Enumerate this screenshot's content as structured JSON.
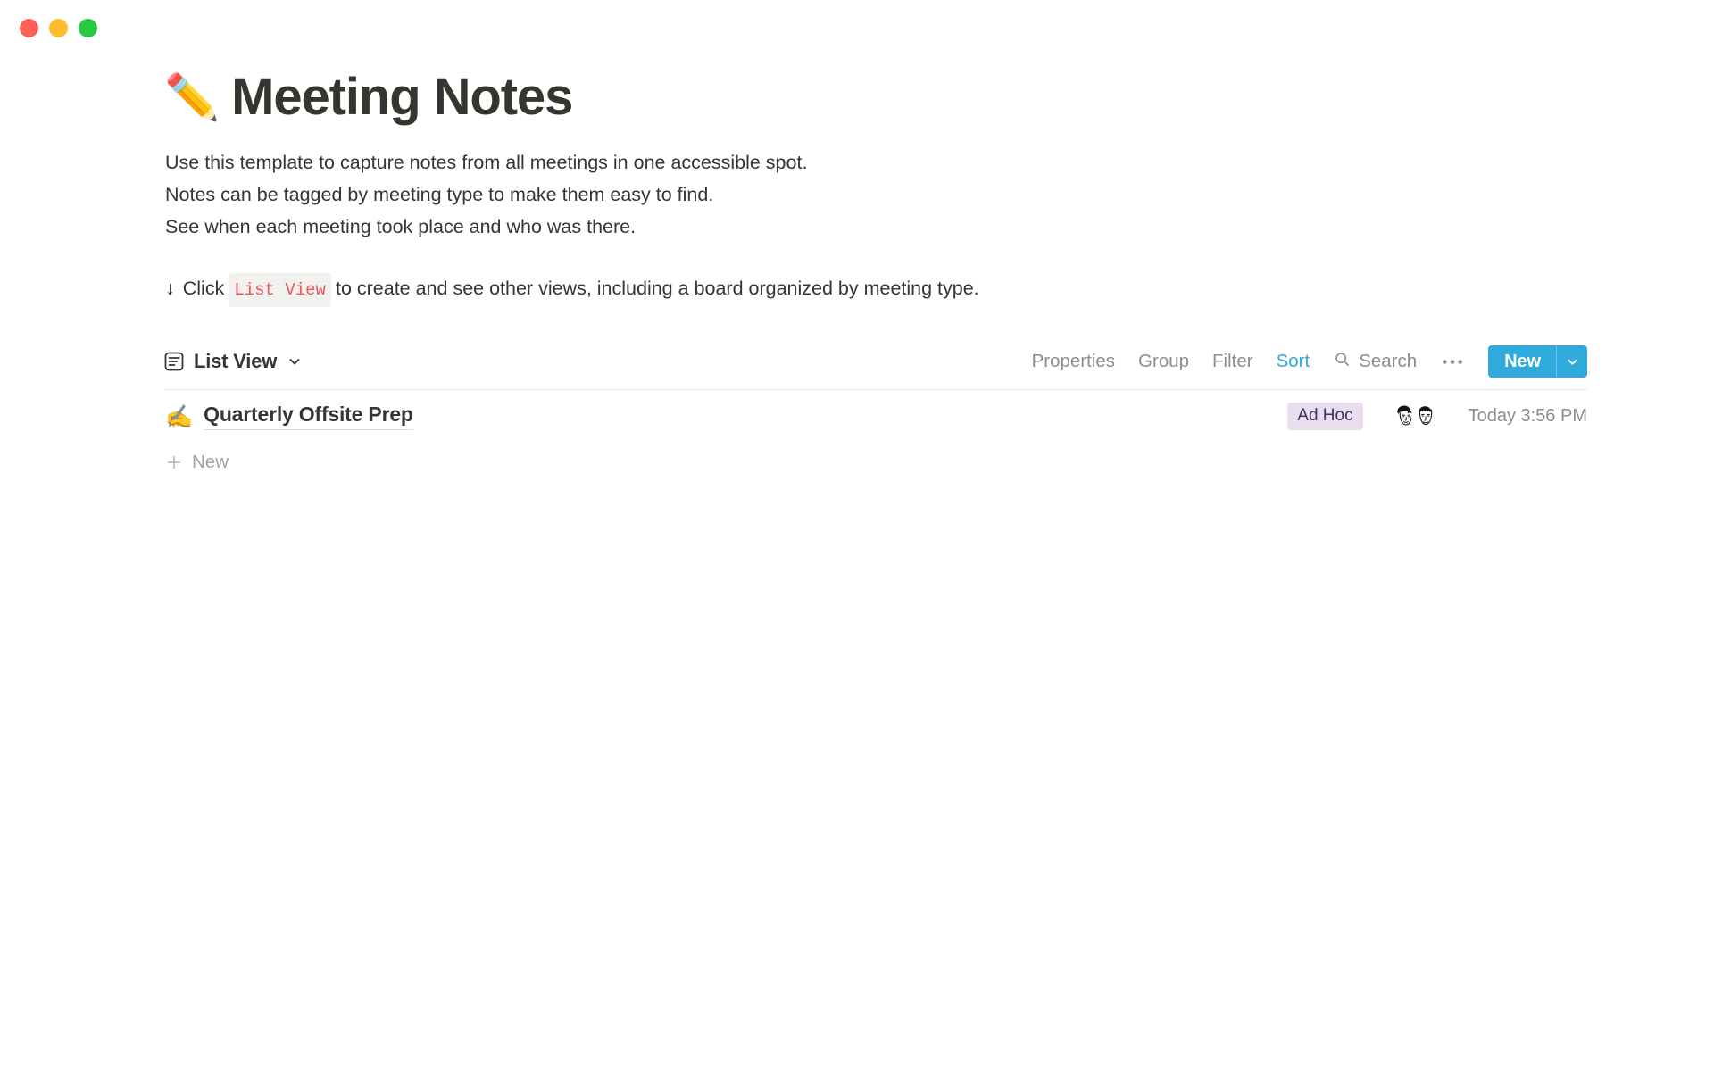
{
  "window": {
    "traffic_lights": [
      {
        "name": "close",
        "color": "#ff5f57"
      },
      {
        "name": "minimize",
        "color": "#febc2e"
      },
      {
        "name": "maximize",
        "color": "#28c840"
      }
    ]
  },
  "page": {
    "emoji": "✏️",
    "title": "Meeting Notes",
    "description_lines": [
      "Use this template to capture notes from all meetings in one accessible spot.",
      "Notes can be tagged by meeting type to make them easy to find.",
      "See when each meeting took place and who was there."
    ],
    "callout": {
      "arrow": "↓",
      "before": "Click",
      "code": "List View",
      "after": "to create and see other views, including a board organized by meeting type."
    }
  },
  "toolbar": {
    "view_icon": "list-view-icon",
    "view_label": "List View",
    "view_caret": "chevron-down-icon",
    "items": [
      {
        "label": "Properties",
        "active": false
      },
      {
        "label": "Group",
        "active": false
      },
      {
        "label": "Filter",
        "active": false
      },
      {
        "label": "Sort",
        "active": true
      }
    ],
    "search_label": "Search",
    "more_label": "•••",
    "new_label": "New",
    "new_caret": "chevron-down-icon",
    "accent_color": "#2eaadc",
    "muted_color": "#8e8d89"
  },
  "list": {
    "rows": [
      {
        "emoji": "✍️",
        "title": "Quarterly Offsite Prep",
        "tag": "Ad Hoc",
        "tag_bg": "#e8deee",
        "tag_color": "#442f64",
        "avatars": 2,
        "date": "Today 3:56 PM"
      }
    ],
    "new_row_label": "New",
    "new_row_icon": "plus-icon"
  }
}
